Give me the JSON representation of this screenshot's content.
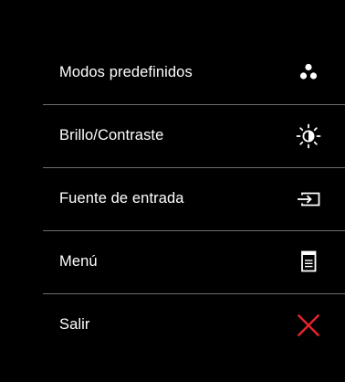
{
  "menu": {
    "items": [
      {
        "label": "Modos predefinidos",
        "icon": "preset-modes-icon"
      },
      {
        "label": "Brillo/Contraste",
        "icon": "brightness-contrast-icon"
      },
      {
        "label": "Fuente de entrada",
        "icon": "input-source-icon"
      },
      {
        "label": "Menú",
        "icon": "menu-document-icon"
      },
      {
        "label": "Salir",
        "icon": "exit-x-icon"
      }
    ]
  },
  "colors": {
    "background": "#000000",
    "text": "#ffffff",
    "divider": "#6e6e6e",
    "exit_icon": "#e8232a"
  }
}
